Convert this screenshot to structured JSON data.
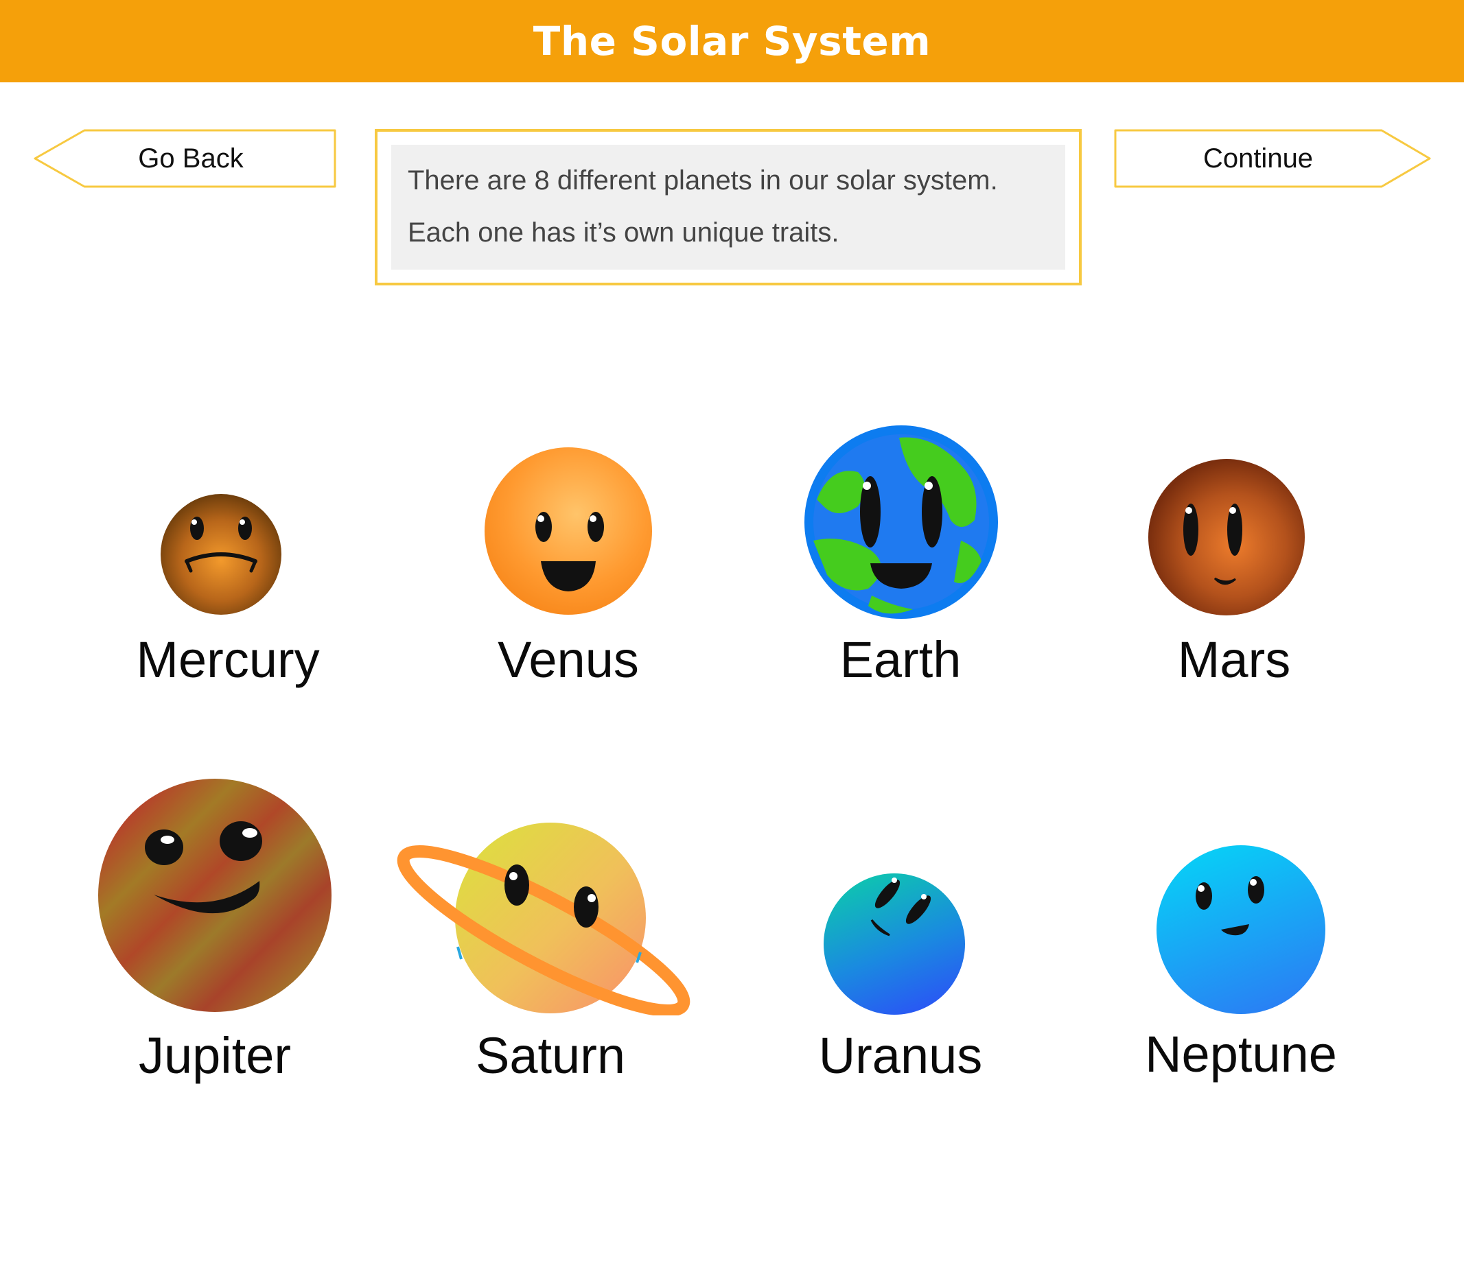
{
  "header": {
    "title": "The Solar System"
  },
  "nav": {
    "back_label": "Go Back",
    "continue_label": "Continue"
  },
  "info": {
    "line1": "There are 8 different planets in our solar system.",
    "line2": "Each one has it’s own unique traits."
  },
  "colors": {
    "header": "#f5a00a",
    "border": "#f7c941",
    "panel": "#f0f0f0"
  },
  "planets": [
    {
      "name": "Mercury",
      "icon": "mercury-icon"
    },
    {
      "name": "Venus",
      "icon": "venus-icon"
    },
    {
      "name": "Earth",
      "icon": "earth-icon"
    },
    {
      "name": "Mars",
      "icon": "mars-icon"
    },
    {
      "name": "Jupiter",
      "icon": "jupiter-icon"
    },
    {
      "name": "Saturn",
      "icon": "saturn-icon"
    },
    {
      "name": "Uranus",
      "icon": "uranus-icon"
    },
    {
      "name": "Neptune",
      "icon": "neptune-icon"
    }
  ]
}
